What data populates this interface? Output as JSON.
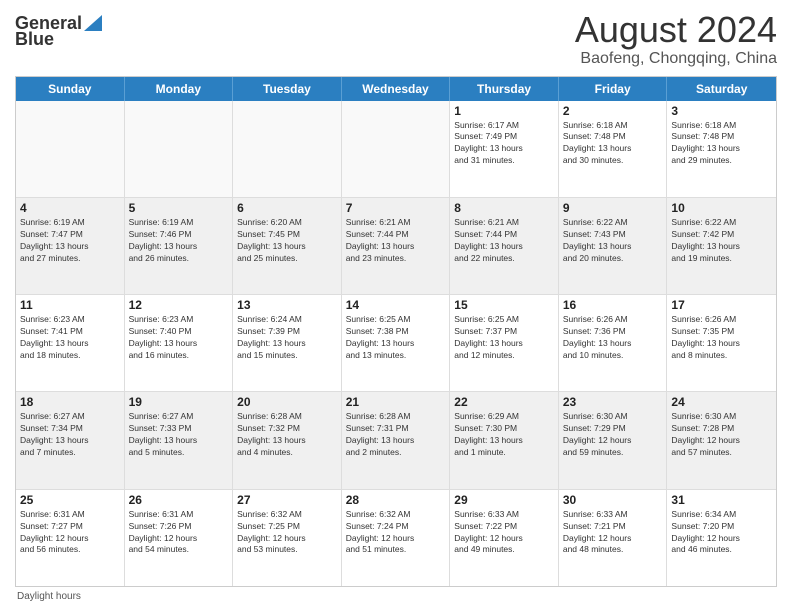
{
  "header": {
    "logo_general": "General",
    "logo_blue": "Blue",
    "month_title": "August 2024",
    "location": "Baofeng, Chongqing, China"
  },
  "days_of_week": [
    "Sunday",
    "Monday",
    "Tuesday",
    "Wednesday",
    "Thursday",
    "Friday",
    "Saturday"
  ],
  "footer": {
    "daylight_label": "Daylight hours"
  },
  "weeks": [
    {
      "cells": [
        {
          "day": "",
          "info": "",
          "empty": true
        },
        {
          "day": "",
          "info": "",
          "empty": true
        },
        {
          "day": "",
          "info": "",
          "empty": true
        },
        {
          "day": "",
          "info": "",
          "empty": true
        },
        {
          "day": "1",
          "info": "Sunrise: 6:17 AM\nSunset: 7:49 PM\nDaylight: 13 hours\nand 31 minutes."
        },
        {
          "day": "2",
          "info": "Sunrise: 6:18 AM\nSunset: 7:48 PM\nDaylight: 13 hours\nand 30 minutes."
        },
        {
          "day": "3",
          "info": "Sunrise: 6:18 AM\nSunset: 7:48 PM\nDaylight: 13 hours\nand 29 minutes."
        }
      ]
    },
    {
      "cells": [
        {
          "day": "4",
          "info": "Sunrise: 6:19 AM\nSunset: 7:47 PM\nDaylight: 13 hours\nand 27 minutes."
        },
        {
          "day": "5",
          "info": "Sunrise: 6:19 AM\nSunset: 7:46 PM\nDaylight: 13 hours\nand 26 minutes."
        },
        {
          "day": "6",
          "info": "Sunrise: 6:20 AM\nSunset: 7:45 PM\nDaylight: 13 hours\nand 25 minutes."
        },
        {
          "day": "7",
          "info": "Sunrise: 6:21 AM\nSunset: 7:44 PM\nDaylight: 13 hours\nand 23 minutes."
        },
        {
          "day": "8",
          "info": "Sunrise: 6:21 AM\nSunset: 7:44 PM\nDaylight: 13 hours\nand 22 minutes."
        },
        {
          "day": "9",
          "info": "Sunrise: 6:22 AM\nSunset: 7:43 PM\nDaylight: 13 hours\nand 20 minutes."
        },
        {
          "day": "10",
          "info": "Sunrise: 6:22 AM\nSunset: 7:42 PM\nDaylight: 13 hours\nand 19 minutes."
        }
      ]
    },
    {
      "cells": [
        {
          "day": "11",
          "info": "Sunrise: 6:23 AM\nSunset: 7:41 PM\nDaylight: 13 hours\nand 18 minutes."
        },
        {
          "day": "12",
          "info": "Sunrise: 6:23 AM\nSunset: 7:40 PM\nDaylight: 13 hours\nand 16 minutes."
        },
        {
          "day": "13",
          "info": "Sunrise: 6:24 AM\nSunset: 7:39 PM\nDaylight: 13 hours\nand 15 minutes."
        },
        {
          "day": "14",
          "info": "Sunrise: 6:25 AM\nSunset: 7:38 PM\nDaylight: 13 hours\nand 13 minutes."
        },
        {
          "day": "15",
          "info": "Sunrise: 6:25 AM\nSunset: 7:37 PM\nDaylight: 13 hours\nand 12 minutes."
        },
        {
          "day": "16",
          "info": "Sunrise: 6:26 AM\nSunset: 7:36 PM\nDaylight: 13 hours\nand 10 minutes."
        },
        {
          "day": "17",
          "info": "Sunrise: 6:26 AM\nSunset: 7:35 PM\nDaylight: 13 hours\nand 8 minutes."
        }
      ]
    },
    {
      "cells": [
        {
          "day": "18",
          "info": "Sunrise: 6:27 AM\nSunset: 7:34 PM\nDaylight: 13 hours\nand 7 minutes."
        },
        {
          "day": "19",
          "info": "Sunrise: 6:27 AM\nSunset: 7:33 PM\nDaylight: 13 hours\nand 5 minutes."
        },
        {
          "day": "20",
          "info": "Sunrise: 6:28 AM\nSunset: 7:32 PM\nDaylight: 13 hours\nand 4 minutes."
        },
        {
          "day": "21",
          "info": "Sunrise: 6:28 AM\nSunset: 7:31 PM\nDaylight: 13 hours\nand 2 minutes."
        },
        {
          "day": "22",
          "info": "Sunrise: 6:29 AM\nSunset: 7:30 PM\nDaylight: 13 hours\nand 1 minute."
        },
        {
          "day": "23",
          "info": "Sunrise: 6:30 AM\nSunset: 7:29 PM\nDaylight: 12 hours\nand 59 minutes."
        },
        {
          "day": "24",
          "info": "Sunrise: 6:30 AM\nSunset: 7:28 PM\nDaylight: 12 hours\nand 57 minutes."
        }
      ]
    },
    {
      "cells": [
        {
          "day": "25",
          "info": "Sunrise: 6:31 AM\nSunset: 7:27 PM\nDaylight: 12 hours\nand 56 minutes."
        },
        {
          "day": "26",
          "info": "Sunrise: 6:31 AM\nSunset: 7:26 PM\nDaylight: 12 hours\nand 54 minutes."
        },
        {
          "day": "27",
          "info": "Sunrise: 6:32 AM\nSunset: 7:25 PM\nDaylight: 12 hours\nand 53 minutes."
        },
        {
          "day": "28",
          "info": "Sunrise: 6:32 AM\nSunset: 7:24 PM\nDaylight: 12 hours\nand 51 minutes."
        },
        {
          "day": "29",
          "info": "Sunrise: 6:33 AM\nSunset: 7:22 PM\nDaylight: 12 hours\nand 49 minutes."
        },
        {
          "day": "30",
          "info": "Sunrise: 6:33 AM\nSunset: 7:21 PM\nDaylight: 12 hours\nand 48 minutes."
        },
        {
          "day": "31",
          "info": "Sunrise: 6:34 AM\nSunset: 7:20 PM\nDaylight: 12 hours\nand 46 minutes."
        }
      ]
    }
  ]
}
